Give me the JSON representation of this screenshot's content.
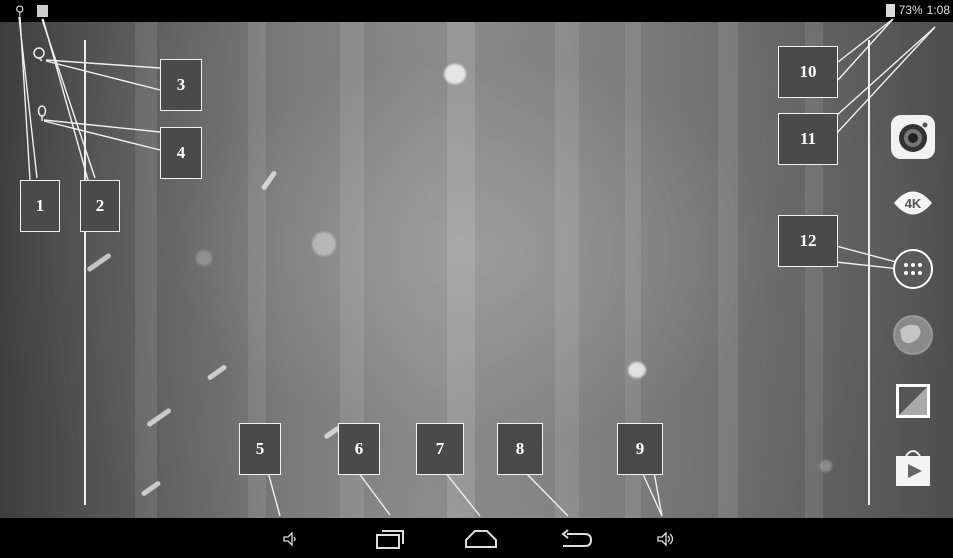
{
  "status_bar": {
    "battery_percent": "73%",
    "time": "1:08",
    "icons": [
      "usb-icon",
      "notification-icon"
    ],
    "side_icons": [
      "alarm-icon",
      "location-icon"
    ]
  },
  "callouts": [
    {
      "label": "1"
    },
    {
      "label": "2"
    },
    {
      "label": "3"
    },
    {
      "label": "4"
    },
    {
      "label": "5"
    },
    {
      "label": "6"
    },
    {
      "label": "7"
    },
    {
      "label": "8"
    },
    {
      "label": "9"
    },
    {
      "label": "10"
    },
    {
      "label": "11"
    },
    {
      "label": "12"
    }
  ],
  "dock_apps": [
    {
      "name": "camera-app-icon"
    },
    {
      "name": "4k-player-app-icon",
      "label": "4K"
    },
    {
      "name": "all-apps-icon"
    },
    {
      "name": "browser-app-icon"
    },
    {
      "name": "gallery-app-icon"
    },
    {
      "name": "play-store-app-icon"
    }
  ],
  "nav_bar": {
    "buttons": [
      "volume-down-button",
      "recent-apps-button",
      "home-button",
      "back-button",
      "volume-up-button"
    ]
  }
}
